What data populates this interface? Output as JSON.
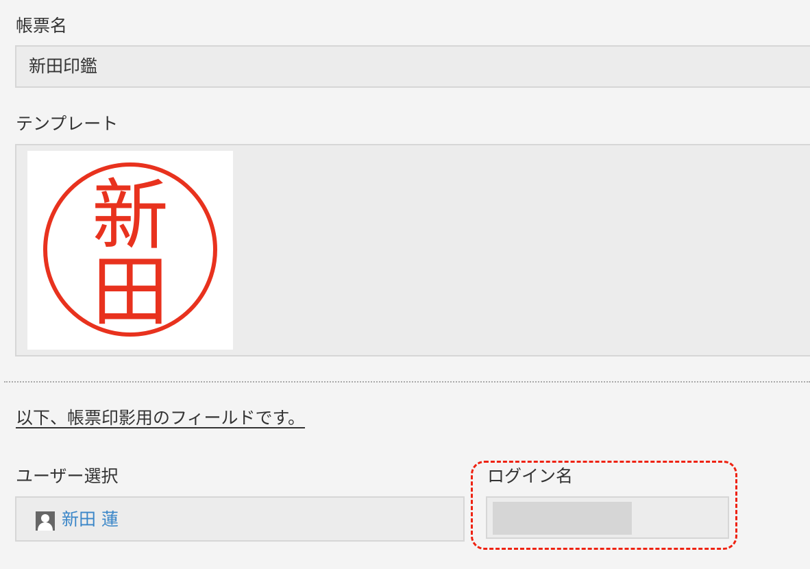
{
  "doc_name": {
    "label": "帳票名",
    "value": "新田印鑑"
  },
  "template": {
    "label": "テンプレート",
    "stamp_text": [
      "新",
      "田"
    ],
    "stamp_color": "#e8321e"
  },
  "section": {
    "note": "以下、帳票印影用のフィールドです。"
  },
  "user_select": {
    "label": "ユーザー選択",
    "user_name": "新田 蓮",
    "avatar_icon": "user-silhouette-icon",
    "link_color": "#3a86c8"
  },
  "login_name": {
    "label": "ログイン名",
    "value": ""
  },
  "annotation": {
    "highlight_color": "#ee2211"
  }
}
